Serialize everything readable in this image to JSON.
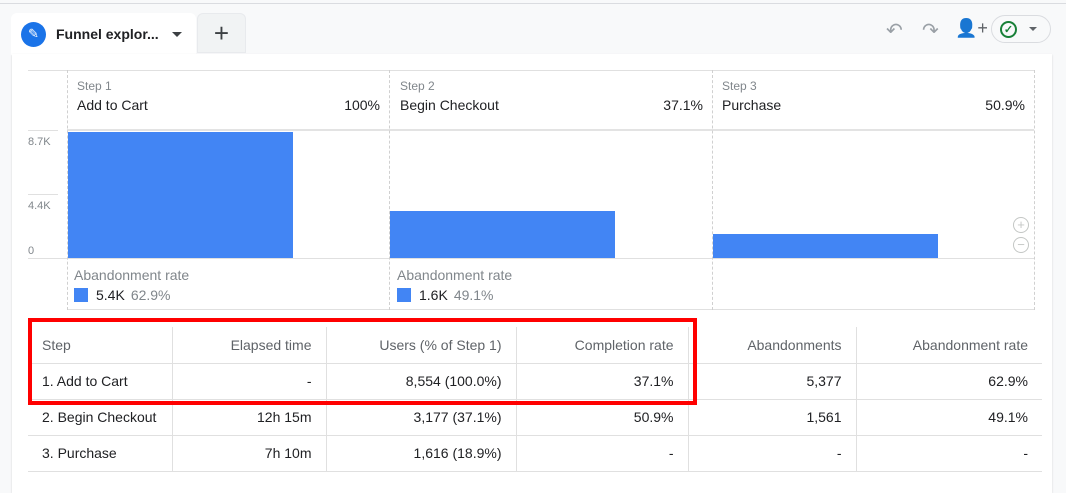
{
  "tabs": {
    "active_label": "Funnel explor...",
    "add_label": "+"
  },
  "toolbar": {
    "undo": "undo-icon",
    "redo": "redo-icon",
    "share": "person-add-icon",
    "status": "check-circle-icon"
  },
  "colors": {
    "bar": "#4285f4",
    "highlight": "#ff0000",
    "accent": "#1a73e8"
  },
  "chart": {
    "y_ticks": [
      "8.7K",
      "4.4K",
      "0"
    ],
    "steps": [
      {
        "label": "Step 1",
        "name": "Add to Cart",
        "pct": "100%",
        "users": 8554,
        "abandon_title": "Abandonment rate",
        "abandon_count": "5.4K",
        "abandon_pct": "62.9%"
      },
      {
        "label": "Step 2",
        "name": "Begin Checkout",
        "pct": "37.1%",
        "users": 3177,
        "abandon_title": "Abandonment rate",
        "abandon_count": "1.6K",
        "abandon_pct": "49.1%"
      },
      {
        "label": "Step 3",
        "name": "Purchase",
        "pct": "50.9%",
        "users": 1616
      }
    ]
  },
  "table": {
    "headers": [
      "Step",
      "Elapsed time",
      "Users (% of Step 1)",
      "Completion rate",
      "Abandonments",
      "Abandonment rate"
    ],
    "rows": [
      [
        "1. Add to Cart",
        "-",
        "8,554 (100.0%)",
        "37.1%",
        "5,377",
        "62.9%"
      ],
      [
        "2. Begin Checkout",
        "12h 15m",
        "3,177 (37.1%)",
        "50.9%",
        "1,561",
        "49.1%"
      ],
      [
        "3. Purchase",
        "7h 10m",
        "1,616 (18.9%)",
        "-",
        "-",
        "-"
      ]
    ]
  }
}
